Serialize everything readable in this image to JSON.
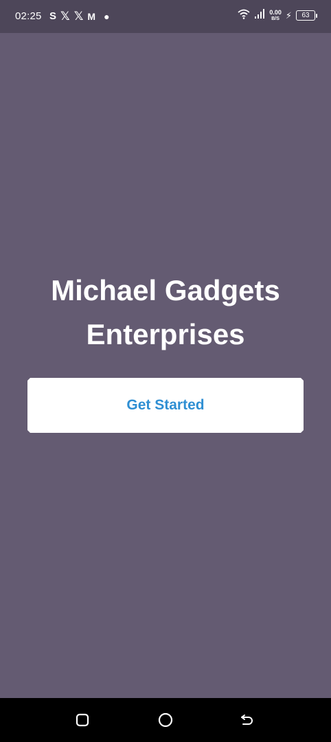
{
  "status_bar": {
    "time": "02:25",
    "left_icons": [
      "s-app-icon",
      "x-icon",
      "x-icon",
      "gmail-icon",
      "dot-icon"
    ],
    "net_speed_value": "0.00",
    "net_speed_unit": "B/S",
    "battery_level": "63",
    "right_icons": [
      "wifi-icon",
      "signal-icon",
      "charging-bolt-icon",
      "battery-icon"
    ]
  },
  "main": {
    "title_line1": "Michael Gadgets",
    "title_line2": "Enterprises",
    "cta_label": "Get Started"
  },
  "nav_bar": {
    "buttons": [
      "recent-apps",
      "home",
      "back"
    ]
  },
  "colors": {
    "background": "#645b72",
    "status_bar": "#4d4659",
    "button_bg": "#ffffff",
    "button_text": "#2f8fd3",
    "nav_bar": "#000000"
  }
}
